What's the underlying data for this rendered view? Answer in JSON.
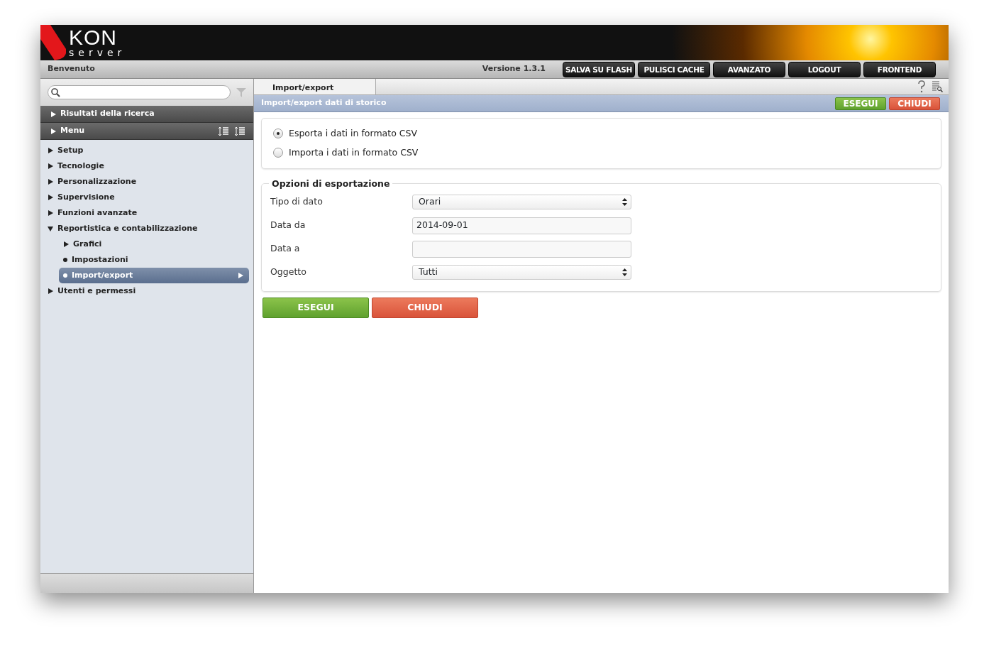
{
  "header": {
    "logo": {
      "title": "KON",
      "subtitle": "server"
    },
    "welcome": "Benvenuto",
    "version": "Versione 1.3.1",
    "buttons": [
      "SALVA SU FLASH",
      "PULISCI CACHE",
      "AVANZATO",
      "LOGOUT",
      "FRONTEND"
    ]
  },
  "sidebar": {
    "sections": [
      {
        "label": "Risultati della ricerca",
        "expanded": false,
        "tools": false
      },
      {
        "label": "Menu",
        "expanded": false,
        "tools": true
      }
    ],
    "items": [
      {
        "label": "Setup",
        "kind": "folder",
        "expanded": false,
        "selected": false
      },
      {
        "label": "Tecnologie",
        "kind": "folder",
        "expanded": false,
        "selected": false
      },
      {
        "label": "Personalizzazione",
        "kind": "folder",
        "expanded": false,
        "selected": false
      },
      {
        "label": "Supervisione",
        "kind": "folder",
        "expanded": false,
        "selected": false
      },
      {
        "label": "Funzioni avanzate",
        "kind": "folder",
        "expanded": false,
        "selected": false
      },
      {
        "label": "Reportistica e contabilizzazione",
        "kind": "folder",
        "expanded": true,
        "selected": false,
        "children": [
          {
            "label": "Grafici",
            "kind": "folder",
            "expanded": false,
            "selected": false
          },
          {
            "label": "Impostazioni",
            "kind": "leaf",
            "selected": false
          },
          {
            "label": "Import/export",
            "kind": "leaf",
            "selected": true
          }
        ]
      },
      {
        "label": "Utenti e permessi",
        "kind": "folder",
        "expanded": false,
        "selected": false
      }
    ]
  },
  "tabs": [
    {
      "label": "Import/export",
      "selected": true
    }
  ],
  "panel": {
    "title": "Import/export dati di storico",
    "toolbar": [
      {
        "label": "ESEGUI",
        "kind": "run"
      },
      {
        "label": "CHIUDI",
        "kind": "close"
      }
    ],
    "modes": [
      {
        "label": "Esporta i dati in formato CSV",
        "selected": true
      },
      {
        "label": "Importa i dati in formato CSV",
        "selected": false
      }
    ],
    "options": {
      "legend": "Opzioni di esportazione",
      "fields": [
        {
          "label": "Tipo di dato",
          "kind": "select",
          "value": "Orari"
        },
        {
          "label": "Data da",
          "kind": "input",
          "value": "2014-09-01"
        },
        {
          "label": "Data a",
          "kind": "input"
        },
        {
          "label": "Oggetto",
          "kind": "select",
          "value": "Tutti"
        }
      ]
    },
    "buttons": [
      {
        "label": "ESEGUI",
        "kind": "run"
      },
      {
        "label": "CHIUDI",
        "kind": "close"
      }
    ]
  }
}
